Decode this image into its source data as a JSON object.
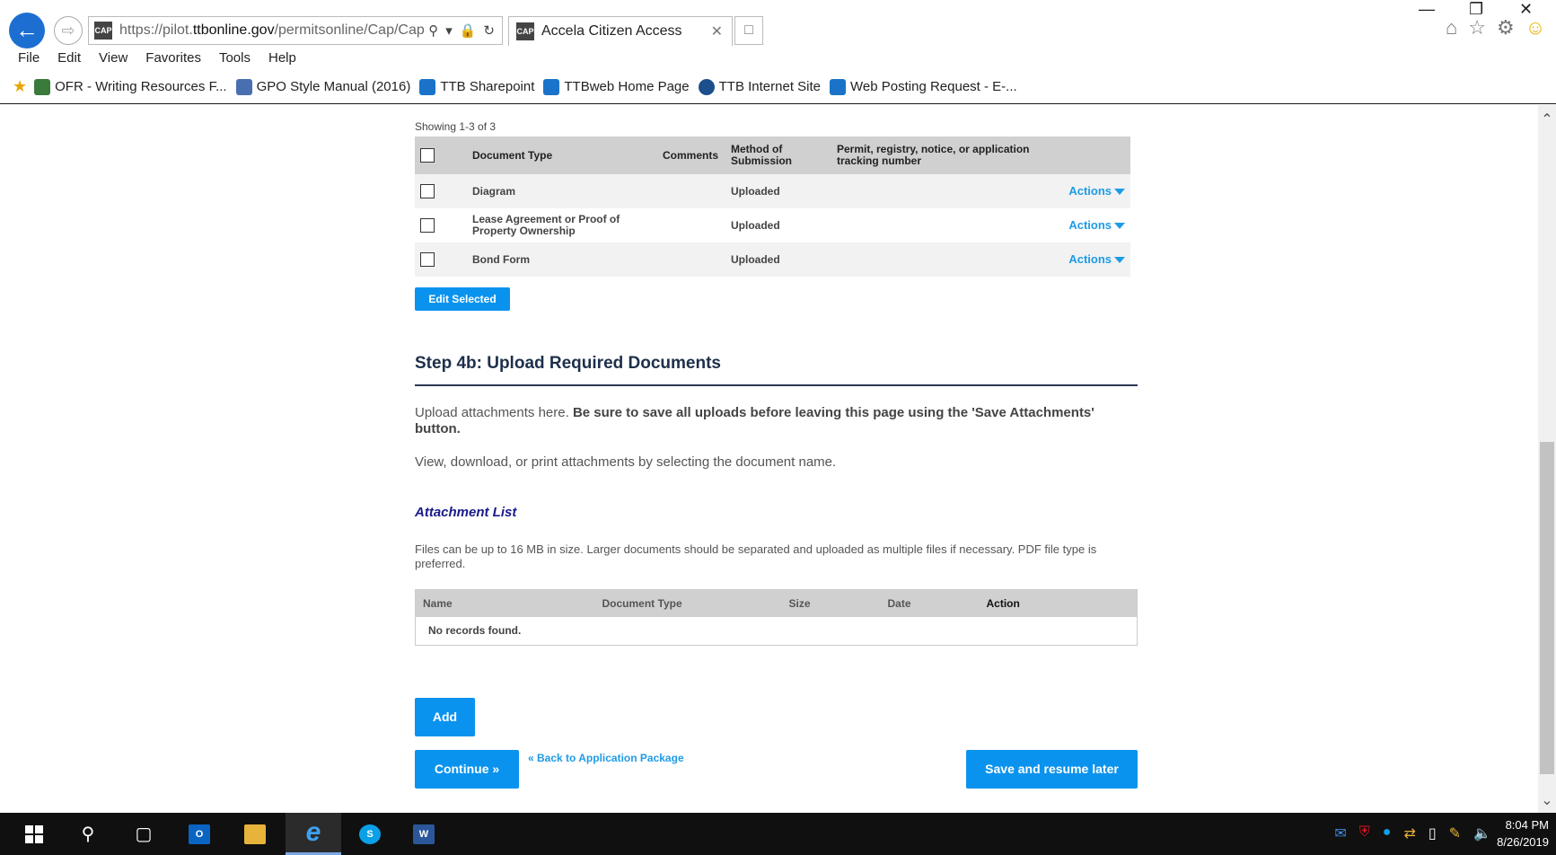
{
  "browser": {
    "url_prefix": "https://pilot.",
    "url_domain": "ttbonline.gov",
    "url_path": "/permitsonline/Cap/Cap",
    "tab_title": "Accela Citizen Access",
    "favicon_text": "CAP",
    "menu": [
      "File",
      "Edit",
      "View",
      "Favorites",
      "Tools",
      "Help"
    ],
    "favorites": [
      {
        "label": "OFR - Writing Resources F...",
        "icon": "page-icon",
        "color": "#3a7a3a"
      },
      {
        "label": "GPO Style Manual (2016)",
        "icon": "gpo-icon",
        "color": "#4a6fb0"
      },
      {
        "label": "TTB Sharepoint",
        "icon": "sharepoint-icon",
        "color": "#1a73c8"
      },
      {
        "label": "TTBweb Home Page",
        "icon": "sharepoint-icon",
        "color": "#1a73c8"
      },
      {
        "label": "TTB Internet Site",
        "icon": "seal-icon",
        "color": "#1c4f8c"
      },
      {
        "label": "Web Posting Request - E-...",
        "icon": "sharepoint-icon",
        "color": "#1a73c8"
      }
    ]
  },
  "documents": {
    "showing": "Showing 1-3 of 3",
    "headers": {
      "type": "Document Type",
      "comments": "Comments",
      "method": "Method of Submission",
      "tracking": "Permit, registry, notice, or application tracking number"
    },
    "rows": [
      {
        "type": "Diagram",
        "comments": "",
        "method": "Uploaded",
        "tracking": "",
        "action": "Actions"
      },
      {
        "type": "Lease Agreement or Proof of Property Ownership",
        "comments": "",
        "method": "Uploaded",
        "tracking": "",
        "action": "Actions"
      },
      {
        "type": "Bond Form",
        "comments": "",
        "method": "Uploaded",
        "tracking": "",
        "action": "Actions"
      }
    ],
    "edit_selected": "Edit Selected"
  },
  "step": {
    "title": "Step 4b: Upload Required Documents",
    "intro_plain": "Upload attachments here. ",
    "intro_bold": "Be sure to save all uploads before leaving this page using the 'Save Attachments' button.",
    "intro2": "View, download, or print attachments by selecting the document name."
  },
  "attachments": {
    "title": "Attachment List",
    "note": "Files can be up to 16 MB in size. Larger documents should be separated and uploaded as multiple files if necessary. PDF file type is preferred.",
    "headers": {
      "name": "Name",
      "type": "Document Type",
      "size": "Size",
      "date": "Date",
      "action": "Action"
    },
    "empty": "No records found."
  },
  "buttons": {
    "add": "Add",
    "continue": "Continue »",
    "back": "« Back to Application Package",
    "save": "Save and resume later"
  },
  "taskbar": {
    "time": "8:04 PM",
    "date": "8/26/2019"
  },
  "colors": {
    "accent": "#0a93ee",
    "link": "#1e9be6",
    "heading": "#1d2f4a",
    "attachment_title": "#1a1a8a"
  }
}
